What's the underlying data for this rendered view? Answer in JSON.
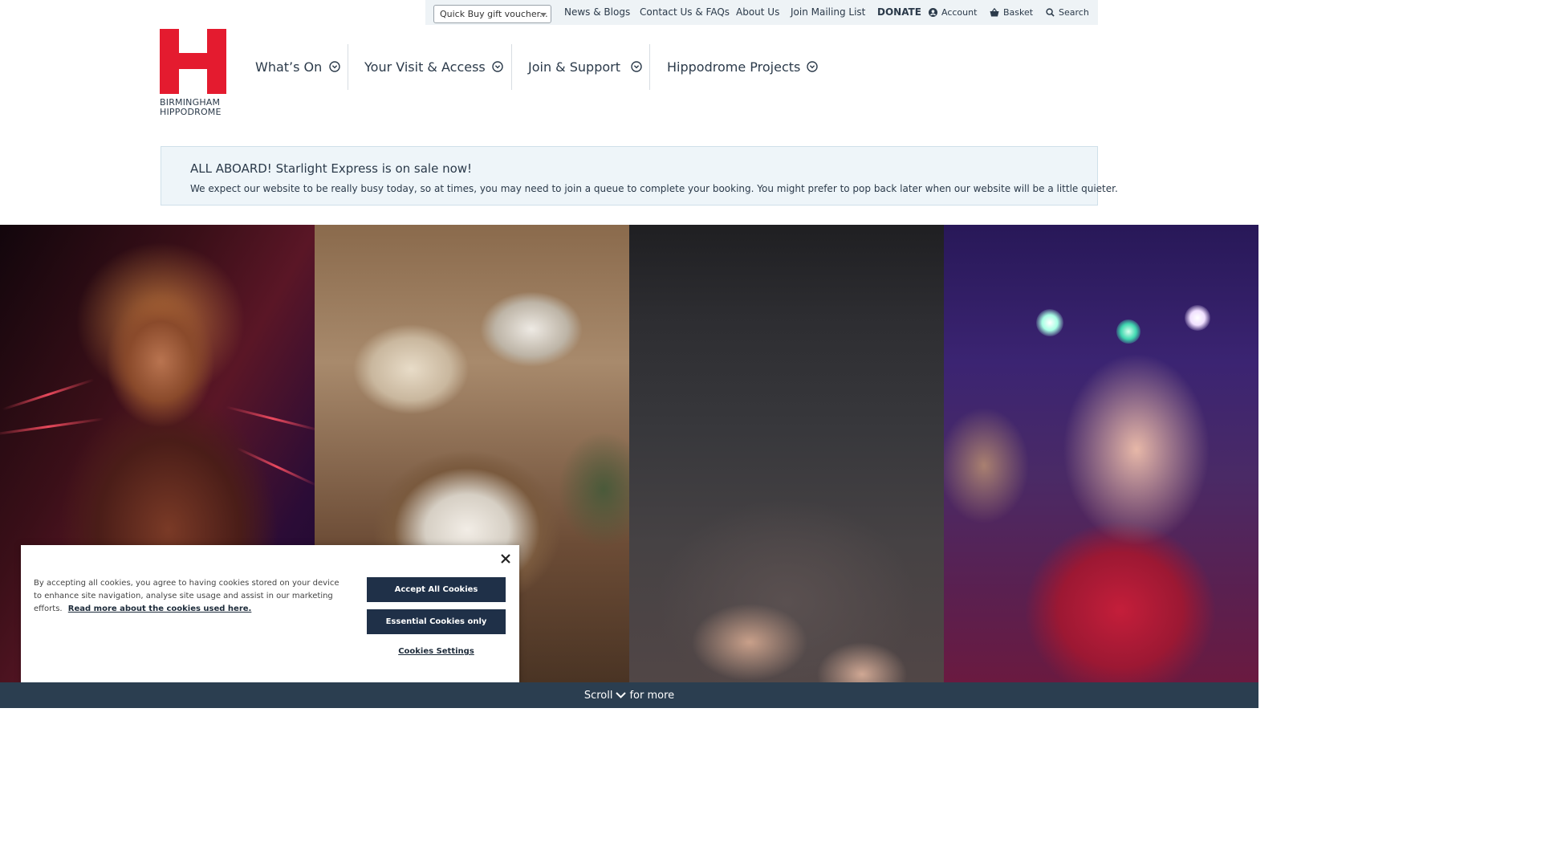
{
  "utility": {
    "quick_buy_value": "Quick Buy gift voucher...",
    "links": [
      "News & Blogs",
      "Contact Us & FAQs",
      "About Us",
      "Join Mailing List"
    ],
    "donate": "DONATE",
    "account": "Account",
    "basket": "Basket",
    "search": "Search"
  },
  "logo": {
    "line1": "BIRMINGHAM",
    "line2": "HIPPODROME",
    "brand_color": "#e41b2f"
  },
  "nav": {
    "items": [
      "What’s On",
      "Your Visit & Access",
      "Join & Support",
      "Hippodrome Projects"
    ]
  },
  "alert": {
    "title": "ALL ABOARD! Starlight Express is on sale now!",
    "body": "We expect our website to be really busy today, so at times, you may need to join a queue to complete your booking. You might prefer to pop back later when our website will be a little quieter."
  },
  "cookie": {
    "text": "By accepting all cookies, you agree to having cookies stored on your device to enhance site navigation, analyse site usage and assist in our marketing efforts.",
    "link": "Read more about the cookies used here.",
    "accept_all": "Accept All Cookies",
    "essential_only": "Essential Cookies only",
    "settings": "Cookies Settings"
  },
  "scroll": {
    "before": "Scroll",
    "after": "for more"
  },
  "colors": {
    "navy": "#1f3048",
    "strip": "#2b3e50",
    "text": "#2b3a4a"
  }
}
